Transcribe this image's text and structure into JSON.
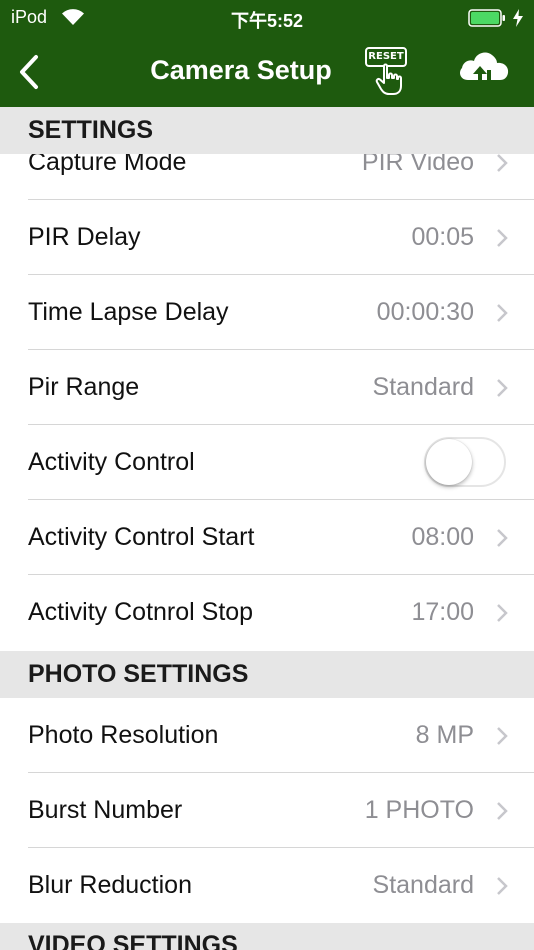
{
  "status_bar": {
    "carrier": "iPod",
    "time": "下午5:52"
  },
  "nav": {
    "title": "Camera Setup",
    "reset_label": "RESET"
  },
  "colors": {
    "nav_bg": "#1e5a0e",
    "section_bg": "#e6e6e6",
    "value_text": "#8e8e93",
    "battery": "#4cd964"
  },
  "sections": {
    "settings": "SETTINGS",
    "photo": "PHOTO SETTINGS",
    "video": "VIDEO SETTINGS"
  },
  "settings_rows": [
    {
      "label": "Capture Mode",
      "value": "PIR Video"
    },
    {
      "label": "PIR Delay",
      "value": "00:05"
    },
    {
      "label": "Time Lapse Delay",
      "value": "00:00:30"
    },
    {
      "label": "Pir Range",
      "value": "Standard"
    },
    {
      "label": "Activity Control",
      "toggle": false
    },
    {
      "label": "Activity Control Start",
      "value": "08:00"
    },
    {
      "label": "Activity Cotnrol Stop",
      "value": "17:00"
    }
  ],
  "photo_rows": [
    {
      "label": "Photo Resolution",
      "value": "8 MP"
    },
    {
      "label": "Burst Number",
      "value": "1 PHOTO"
    },
    {
      "label": "Blur Reduction",
      "value": "Standard"
    }
  ]
}
